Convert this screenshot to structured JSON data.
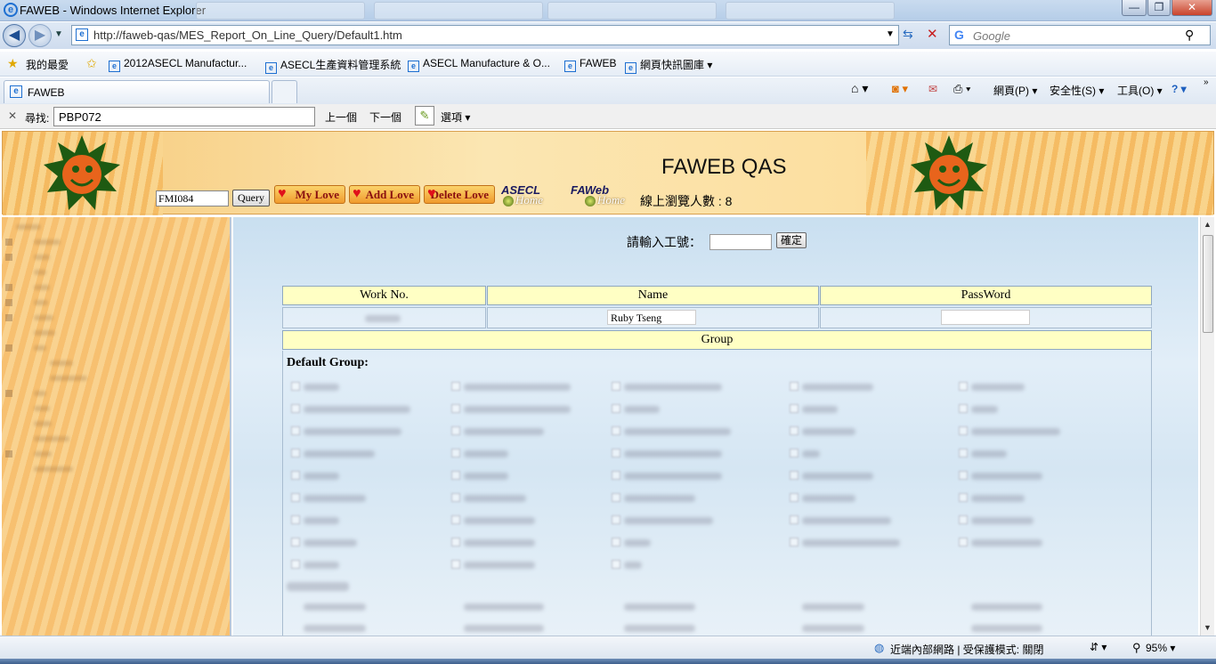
{
  "window": {
    "title": "FAWEB - Windows Internet Explorer",
    "minimize": "—",
    "restore": "❐",
    "close": "✕"
  },
  "address_bar": {
    "url": "http://faweb-qas/MES_Report_On_Line_Query/Default1.htm",
    "search_placeholder": "Google"
  },
  "favorites_bar": {
    "favorites_label": "我的最愛",
    "links": [
      "2012ASECL Manufactur...",
      "ASECL生產資料管理系統",
      "ASECL Manufacture & O...",
      "FAWEB",
      "網頁快訊圖庫"
    ]
  },
  "tabs": {
    "active_tab": "FAWEB"
  },
  "command_bar": {
    "page_menu": "網頁(P)",
    "safety_menu": "安全性(S)",
    "tools_menu": "工具(O)"
  },
  "find_bar": {
    "label": "尋找:",
    "value": "PBP072",
    "prev": "上一個",
    "next": "下一個",
    "options": "選項"
  },
  "banner": {
    "title": "FAWEB QAS",
    "query_value": "FMI084",
    "query_button": "Query",
    "my_love": "My Love",
    "add_love": "Add Love",
    "delete_love": "Delete Love",
    "asecl_logo": "ASECL",
    "faweb_logo": "FAWeb",
    "home_text": "Home",
    "online_label": "線上瀏覽人數 : 8"
  },
  "form": {
    "employee_label": "請輸入工號：",
    "ok_button": "確定",
    "headers": {
      "work_no": "Work No.",
      "name": "Name",
      "password": "PassWord",
      "group": "Group"
    },
    "name_value": "Ruby Tseng",
    "default_group_label": "Default Group:"
  },
  "status_bar": {
    "zone": "近端內部網路 | 受保護模式: 關閉",
    "zoom": "95%"
  }
}
